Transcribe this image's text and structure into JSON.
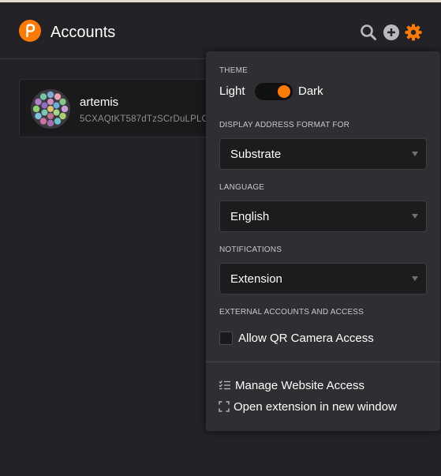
{
  "header": {
    "title": "Accounts",
    "logo_icon": "polkadot-logo",
    "icons": [
      "search-icon",
      "add-account-icon",
      "gear-icon"
    ]
  },
  "account": {
    "name": "artemis",
    "address": "5CXAQtKT587dTzSCrDuLPLC"
  },
  "settings": {
    "theme": {
      "label": "THEME",
      "light_label": "Light",
      "dark_label": "Dark",
      "selected": "Dark"
    },
    "address_format": {
      "label": "DISPLAY ADDRESS FORMAT FOR",
      "value": "Substrate"
    },
    "language": {
      "label": "LANGUAGE",
      "value": "English"
    },
    "notifications": {
      "label": "NOTIFICATIONS",
      "value": "Extension"
    },
    "external": {
      "label": "EXTERNAL ACCOUNTS AND ACCESS",
      "qr_label": "Allow QR Camera Access",
      "qr_checked": false
    },
    "links": {
      "manage_access": "Manage Website Access",
      "open_window": "Open extension in new window"
    }
  },
  "colors": {
    "accent": "#ff7a00",
    "background": "#232327",
    "menu_background": "#2e2e33",
    "card_background": "#1a1a1d"
  }
}
